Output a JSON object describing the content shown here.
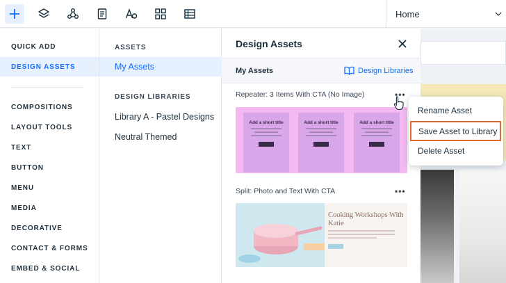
{
  "toolbar": {
    "icons": [
      "plus-icon",
      "layers-icon",
      "apps-icon",
      "pages-icon",
      "text-font-icon",
      "grid-icon",
      "table-icon"
    ],
    "page_select": "Home"
  },
  "categories": {
    "items": [
      "QUICK ADD",
      "DESIGN ASSETS",
      "COMPOSITIONS",
      "LAYOUT TOOLS",
      "TEXT",
      "BUTTON",
      "MENU",
      "MEDIA",
      "DECORATIVE",
      "CONTACT & FORMS",
      "EMBED & SOCIAL"
    ],
    "active": "DESIGN ASSETS"
  },
  "sub_panel": {
    "assets_heading": "ASSETS",
    "my_assets": "My Assets",
    "libraries_heading": "DESIGN LIBRARIES",
    "libraries": [
      "Library A - Pastel Designs",
      "Neutral Themed"
    ]
  },
  "assets_panel": {
    "title": "Design Assets",
    "subtitle": "My Assets",
    "library_link": "Design Libraries",
    "assets": [
      {
        "label": "Repeater: 3 Items With CTA (No Image)",
        "cards": [
          {
            "title": "Add a short title"
          },
          {
            "title": "Add a short title"
          },
          {
            "title": "Add a short title"
          }
        ]
      },
      {
        "label": "Split: Photo and Text With CTA",
        "heading": "Cooking Workshops With Katie"
      }
    ]
  },
  "context_menu": {
    "items": [
      "Rename Asset",
      "Save Asset to Library",
      "Delete Asset"
    ],
    "highlighted": "Save Asset to Library"
  },
  "colors": {
    "accent": "#116dff",
    "highlight_border": "#e2692c",
    "repeater_bg": "#f4b9f1"
  }
}
